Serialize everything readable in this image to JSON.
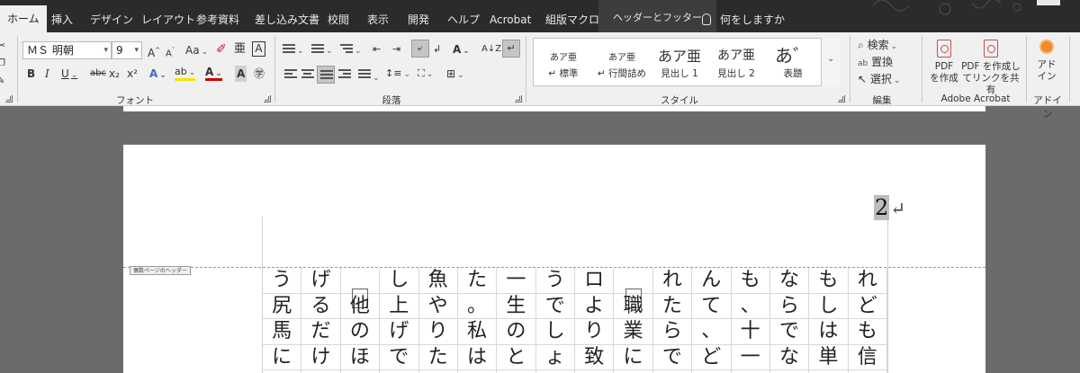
{
  "tabs": [
    {
      "label": "ホーム",
      "active": true
    },
    {
      "label": "挿入"
    },
    {
      "label": "デザイン"
    },
    {
      "label": "レイアウト"
    },
    {
      "label": "参考資料"
    },
    {
      "label": "差し込み文書"
    },
    {
      "label": "校閲"
    },
    {
      "label": "表示"
    },
    {
      "label": "開発"
    },
    {
      "label": "ヘルプ"
    },
    {
      "label": "Acrobat"
    },
    {
      "label": "組版マクロ"
    },
    {
      "label": "ヘッダーとフッター",
      "contextual": true
    }
  ],
  "tell_me": "何をしますか",
  "font": {
    "name": "ＭＳ 明朝",
    "size": "9",
    "grow": "A",
    "shrink": "A",
    "case": "Aa",
    "bold": "B",
    "italic": "I",
    "underline": "U",
    "strike": "abc",
    "subscript": "x₂",
    "superscript": "x²",
    "effects": "A",
    "highlight": "ab",
    "color": "A",
    "shade": "A",
    "group_label": "フォント"
  },
  "paragraph": {
    "group_label": "段落",
    "sort": "A↓Z"
  },
  "styles": {
    "group_label": "スタイル",
    "items": [
      {
        "sample": "あア亜",
        "name": "↵ 標準"
      },
      {
        "sample": "あア亜",
        "name": "↵ 行間詰め"
      },
      {
        "sample": "あア亜",
        "name": "見出し 1"
      },
      {
        "sample": "あア亜",
        "name": "見出し 2"
      },
      {
        "sample": "あ゛",
        "name": "表題"
      }
    ]
  },
  "editing": {
    "group_label": "編集",
    "find": "検索",
    "replace": "置換",
    "select": "選択"
  },
  "acrobat": {
    "group_label": "Adobe Acrobat",
    "create_pdf": [
      "PDF",
      "を作成"
    ],
    "create_share": [
      "PDF を作成し",
      "てリンクを共有"
    ]
  },
  "addin": {
    "group_label": "アドイン",
    "button": [
      "アド",
      "イン"
    ]
  },
  "document": {
    "page_number": "2",
    "return_mark": "↵",
    "header_tag": "偶数ページのヘッダー",
    "columns": [
      [
        "う",
        "尻",
        "馬",
        "に"
      ],
      [
        "げ",
        "る",
        "だ",
        "け"
      ],
      [
        "□",
        "他",
        "の",
        "ほ"
      ],
      [
        "し",
        "上",
        "げ",
        "で"
      ],
      [
        "魚",
        "や",
        "り",
        "た"
      ],
      [
        "た",
        "。",
        "私",
        "は"
      ],
      [
        "一",
        "生",
        "の",
        "と"
      ],
      [
        "う",
        "で",
        "し",
        "ょ"
      ],
      [
        "ロ",
        "よ",
        "り",
        "致"
      ],
      [
        "□",
        "職",
        "業",
        "に"
      ],
      [
        "れ",
        "た",
        "ら",
        "で"
      ],
      [
        "ん",
        "て",
        "、",
        "ど"
      ],
      [
        "も",
        "、",
        "十",
        "一"
      ],
      [
        "な",
        "ら",
        "で",
        "な"
      ],
      [
        "も",
        "し",
        "は",
        "単"
      ],
      [
        "れ",
        "ど",
        "も",
        "信"
      ]
    ]
  }
}
